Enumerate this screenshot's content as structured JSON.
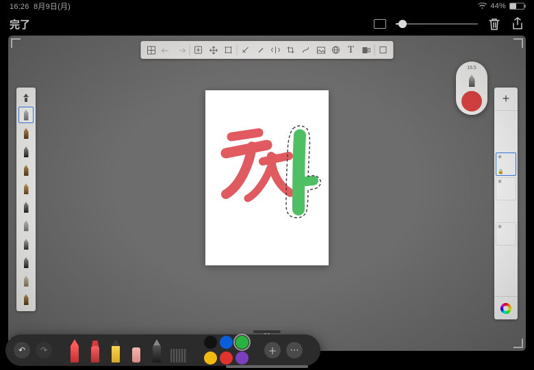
{
  "status": {
    "time": "16:26",
    "date": "8月9日(月)",
    "battery_pct": "44%",
    "battery_fill": 44
  },
  "appbar": {
    "done_label": "完了",
    "opacity_pct": 8
  },
  "top_toolbar": {
    "items": [
      "grid",
      "undo",
      "redo",
      "add",
      "move",
      "transform",
      "cut",
      "brush",
      "mirror",
      "crop",
      "curve",
      "image",
      "web",
      "text",
      "reference",
      "fullscreen"
    ]
  },
  "brush_preview": {
    "size_label": "16.5",
    "color": "#e44545"
  },
  "brush_strip": {
    "header_icon": "brush-settings",
    "selected_index": 0,
    "brushes": [
      "nib-gray",
      "nib-b1",
      "nib-b2",
      "nib-b1",
      "nib-b3",
      "nib-b2",
      "nib-gray",
      "nib-b4",
      "nib-b2",
      "nib-b5",
      "nib-b1"
    ]
  },
  "layers": {
    "add_label": "+",
    "items": [
      {
        "selected": true,
        "visible": true,
        "locked": true
      },
      {
        "selected": false,
        "visible": true,
        "locked": false
      },
      {
        "selected": false,
        "visible": true,
        "locked": false
      }
    ]
  },
  "canvas": {
    "strokes_red": "テスト",
    "selection_shape": "vertical-green-stroke"
  },
  "markup": {
    "tools": [
      "pen",
      "marker",
      "pencil",
      "eraser",
      "lasso",
      "ruler"
    ],
    "colors": [
      "#111111",
      "#0a5fd8",
      "#28b43c",
      "#f2b90f",
      "#e2322e",
      "#7a3fbd"
    ],
    "selected_color_index": 2
  }
}
